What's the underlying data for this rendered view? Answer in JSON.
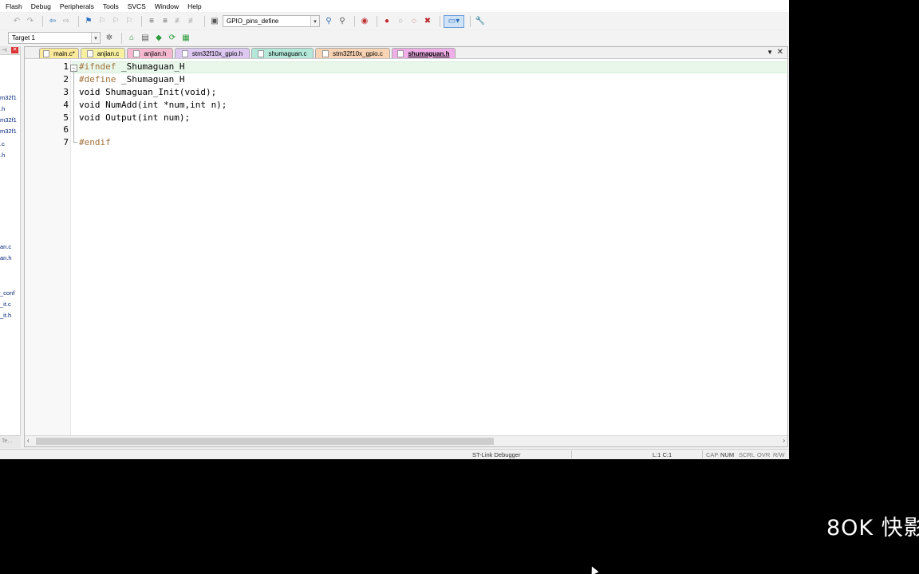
{
  "menu": [
    "Flash",
    "Debug",
    "Peripherals",
    "Tools",
    "SVCS",
    "Window",
    "Help"
  ],
  "toolbar": {
    "file_combo": "GPIO_pins_define"
  },
  "build_toolbar": {
    "target_combo": "Target 1"
  },
  "project_panel": {
    "items": [
      "m32f1",
      ".h",
      "m32f1",
      "m32f1",
      ".c",
      ".h",
      "an.c",
      "an.h",
      "_conf",
      "_it.c",
      "_it.h"
    ],
    "bottom_tab": "Te..."
  },
  "tabs": [
    {
      "label": "main.c*",
      "color": "#fde99a"
    },
    {
      "label": "anjian.c",
      "color": "#f7f0a0"
    },
    {
      "label": "anjian.h",
      "color": "#f5b8cf"
    },
    {
      "label": "stm32f10x_gpio.h",
      "color": "#ddc8f2"
    },
    {
      "label": "shumaguan.c",
      "color": "#b3e8d8"
    },
    {
      "label": "stm32f10x_gpio.c",
      "color": "#f8d3b4"
    },
    {
      "label": "shumaguan.h",
      "color": "#f0aee8"
    }
  ],
  "editor": {
    "line_numbers": [
      "1",
      "2",
      "3",
      "4",
      "5",
      "6",
      "7"
    ],
    "lines": [
      {
        "kw": "#ifndef",
        "rest": " _Shumaguan_H"
      },
      {
        "kw": "#define",
        "rest": " _Shumaguan_H"
      },
      {
        "kw": "",
        "rest": "void Shumaguan_Init(void);"
      },
      {
        "kw": "",
        "rest": "void NumAdd(int *num,int n);"
      },
      {
        "kw": "",
        "rest": "void Output(int num);"
      },
      {
        "kw": "",
        "rest": ""
      },
      {
        "kw": "#endif",
        "rest": ""
      }
    ]
  },
  "status": {
    "debugger": "ST-Link Debugger",
    "position": "L:1 C:1",
    "cap": "CAP",
    "num": "NUM",
    "scrl": "SCRL",
    "ovr": "OVR",
    "rw": "R/W"
  },
  "overlay": {
    "logo": "8OK 快影"
  }
}
